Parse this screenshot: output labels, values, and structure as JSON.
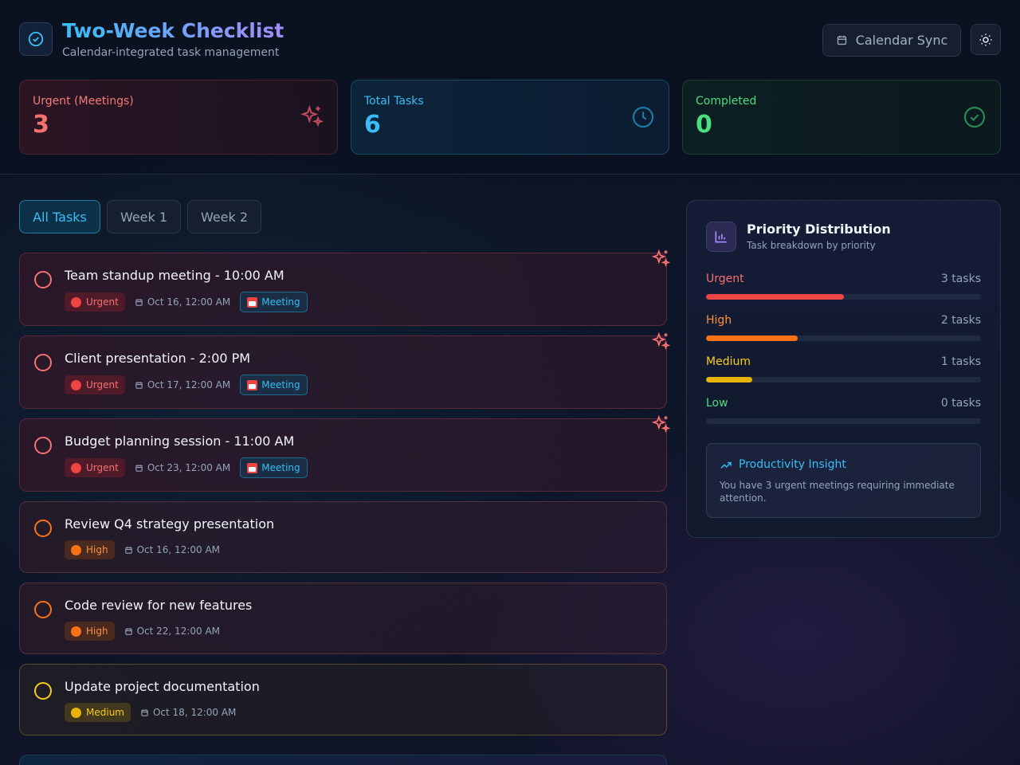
{
  "header": {
    "title": "Two-Week Checklist",
    "subtitle": "Calendar-integrated task management",
    "calendar_sync_label": "Calendar Sync"
  },
  "stats": {
    "urgent": {
      "label": "Urgent (Meetings)",
      "value": "3"
    },
    "total": {
      "label": "Total Tasks",
      "value": "6"
    },
    "completed": {
      "label": "Completed",
      "value": "0"
    }
  },
  "tabs": [
    {
      "label": "All Tasks",
      "active": true
    },
    {
      "label": "Week 1",
      "active": false
    },
    {
      "label": "Week 2",
      "active": false
    }
  ],
  "tasks": [
    {
      "title": "Team standup meeting - 10:00 AM",
      "priority": "Urgent",
      "date": "Oct 16, 12:00 AM",
      "tag": "Meeting"
    },
    {
      "title": "Client presentation - 2:00 PM",
      "priority": "Urgent",
      "date": "Oct 17, 12:00 AM",
      "tag": "Meeting"
    },
    {
      "title": "Budget planning session - 11:00 AM",
      "priority": "Urgent",
      "date": "Oct 23, 12:00 AM",
      "tag": "Meeting"
    },
    {
      "title": "Review Q4 strategy presentation",
      "priority": "High",
      "date": "Oct 16, 12:00 AM"
    },
    {
      "title": "Code review for new features",
      "priority": "High",
      "date": "Oct 22, 12:00 AM"
    },
    {
      "title": "Update project documentation",
      "priority": "Medium",
      "date": "Oct 18, 12:00 AM"
    }
  ],
  "priority_panel": {
    "title": "Priority Distribution",
    "subtitle": "Task breakdown by priority",
    "rows": [
      {
        "label": "Urgent",
        "count": "3 tasks",
        "fraction": 0.5,
        "color": "#ef4444",
        "label_color": "#f87171"
      },
      {
        "label": "High",
        "count": "2 tasks",
        "fraction": 0.333,
        "color": "#f97316",
        "label_color": "#fb923c"
      },
      {
        "label": "Medium",
        "count": "1 tasks",
        "fraction": 0.167,
        "color": "#eab308",
        "label_color": "#facc15"
      },
      {
        "label": "Low",
        "count": "0 tasks",
        "fraction": 0,
        "color": "#22c55e",
        "label_color": "#4ade80"
      }
    ],
    "insight": {
      "title": "Productivity Insight",
      "text": "You have 3 urgent meetings requiring immediate attention."
    }
  },
  "icons": {
    "logo": "check-circle-icon",
    "calendar_sync": "calendar-icon",
    "theme": "sun-icon",
    "urgent_stat": "sparkles-icon",
    "total_stat": "clock-icon",
    "completed_stat": "check-circle-icon",
    "panel": "bar-chart-icon",
    "insight": "trending-up-icon"
  },
  "colors": {
    "accent": "#38bdf8",
    "urgent": "#ef4444",
    "high": "#f97316",
    "medium": "#eab308",
    "success": "#4ade80"
  }
}
